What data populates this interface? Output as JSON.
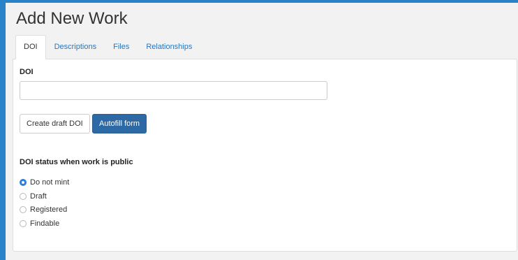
{
  "page": {
    "title": "Add New Work"
  },
  "tabs": [
    {
      "label": "DOI",
      "active": true
    },
    {
      "label": "Descriptions",
      "active": false
    },
    {
      "label": "Files",
      "active": false
    },
    {
      "label": "Relationships",
      "active": false
    }
  ],
  "doi_form": {
    "doi_label": "DOI",
    "doi_value": "",
    "doi_placeholder": "",
    "create_draft_label": "Create draft DOI",
    "autofill_label": "Autofill form",
    "status_heading": "DOI status when work is public",
    "status_options": [
      {
        "label": "Do not mint",
        "checked": true
      },
      {
        "label": "Draft",
        "checked": false
      },
      {
        "label": "Registered",
        "checked": false
      },
      {
        "label": "Findable",
        "checked": false
      }
    ]
  },
  "colors": {
    "frame": "#2a82c8",
    "page_background": "#f2f2f2",
    "link": "#2a75bb",
    "primary_button": "#2d6aa5",
    "radio_selected": "#2a7de1"
  }
}
